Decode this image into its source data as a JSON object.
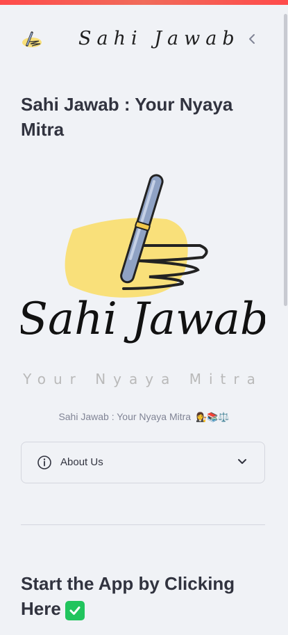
{
  "sidebar": {
    "brand": "Sahi Jawab",
    "title": "Sahi Jawab : Your Nyaya Mitra",
    "logo": {
      "wordmark": "Sahi Jawab",
      "tagline": "Your Nyaya Mitra"
    },
    "caption": "Sahi Jawab : Your Nyaya Mitra",
    "caption_emojis": "👩‍⚖️📚⚖️",
    "expander": {
      "label": "About Us"
    },
    "section_title": "Start the App by Clicking Here"
  },
  "colors": {
    "accent_bar": "#ff4b4b",
    "background": "#f0f2f6",
    "check": "#21c45d",
    "highlight": "#f9e07a"
  }
}
